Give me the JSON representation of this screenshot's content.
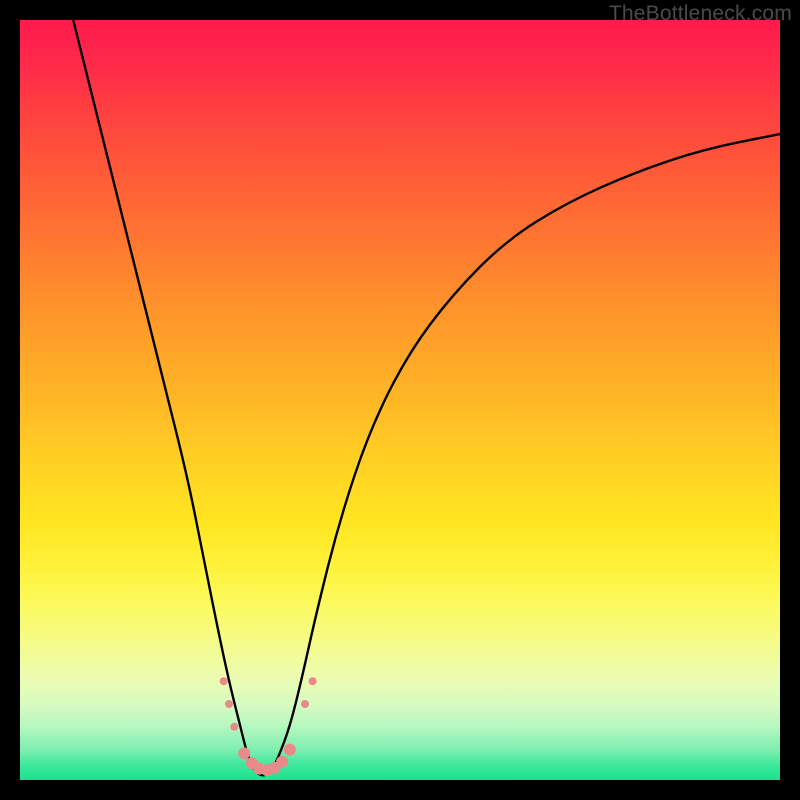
{
  "watermark": {
    "text": "TheBottleneck.com"
  },
  "chart_data": {
    "type": "line",
    "title": "",
    "xlabel": "",
    "ylabel": "",
    "xlim": [
      0,
      100
    ],
    "ylim": [
      0,
      100
    ],
    "grid": false,
    "legend": false,
    "background_gradient": {
      "orientation": "vertical",
      "stops": [
        {
          "pos": 0,
          "color": "#ff1a4d"
        },
        {
          "pos": 50,
          "color": "#ffd024"
        },
        {
          "pos": 80,
          "color": "#f5fb8a"
        },
        {
          "pos": 100,
          "color": "#18e28e"
        }
      ]
    },
    "series": [
      {
        "name": "curve",
        "color": "#000000",
        "x": [
          7,
          10,
          13,
          16,
          19,
          22,
          24,
          26,
          27.5,
          29,
          30,
          31,
          32,
          33,
          34,
          35.5,
          37,
          39,
          42,
          46,
          51,
          57,
          64,
          72,
          81,
          90,
          100
        ],
        "y": [
          100,
          88,
          76,
          64,
          52,
          40,
          30,
          20,
          13,
          7,
          3,
          1,
          0.5,
          1,
          3,
          7,
          13,
          22,
          34,
          46,
          56,
          64,
          71,
          76,
          80,
          83,
          85
        ]
      }
    ],
    "markers": {
      "name": "dots",
      "color": "#e98a8a",
      "radius_small": 4,
      "radius_large": 6,
      "points": [
        {
          "x": 26.8,
          "y": 13,
          "r": "small"
        },
        {
          "x": 27.5,
          "y": 10,
          "r": "small"
        },
        {
          "x": 28.2,
          "y": 7,
          "r": "small"
        },
        {
          "x": 29.5,
          "y": 3.5,
          "r": "large"
        },
        {
          "x": 30.5,
          "y": 2.2,
          "r": "large"
        },
        {
          "x": 31.5,
          "y": 1.5,
          "r": "large"
        },
        {
          "x": 32.5,
          "y": 1.3,
          "r": "large"
        },
        {
          "x": 33.5,
          "y": 1.6,
          "r": "large"
        },
        {
          "x": 34.5,
          "y": 2.4,
          "r": "large"
        },
        {
          "x": 35.5,
          "y": 4.0,
          "r": "large"
        },
        {
          "x": 37.5,
          "y": 10,
          "r": "small"
        },
        {
          "x": 38.5,
          "y": 13,
          "r": "small"
        }
      ]
    }
  }
}
